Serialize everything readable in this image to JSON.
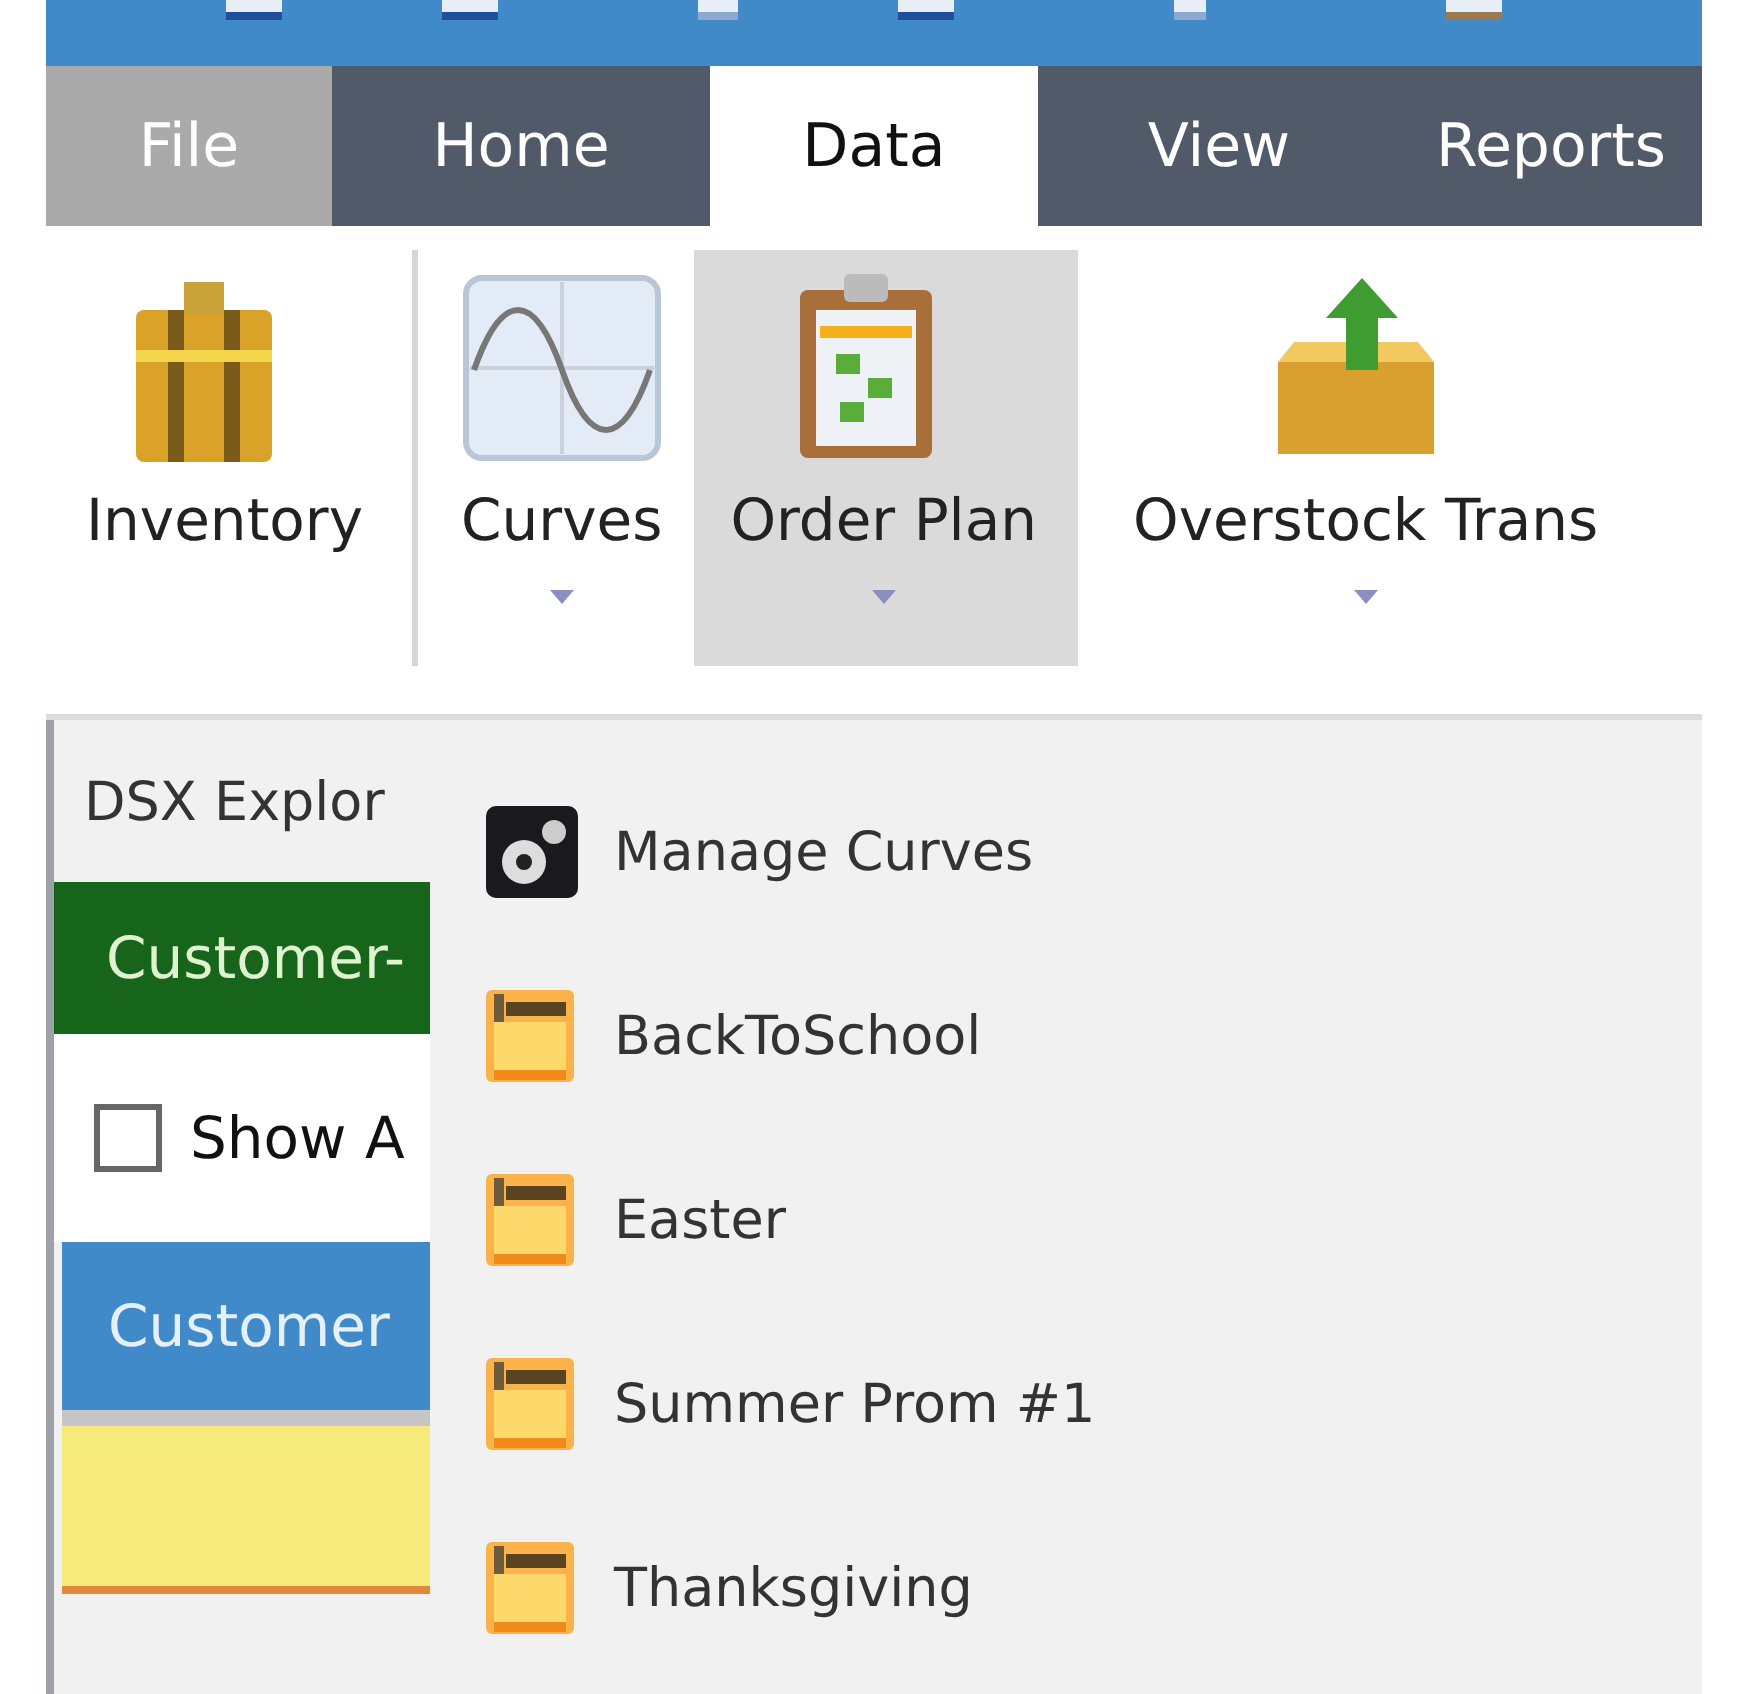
{
  "tabs": [
    {
      "label": "File",
      "kind": "backstage",
      "selected": false
    },
    {
      "label": "Home",
      "kind": "tab",
      "selected": false
    },
    {
      "label": "Data",
      "kind": "tab",
      "selected": true
    },
    {
      "label": "View",
      "kind": "tab",
      "selected": false
    },
    {
      "label": "Reports",
      "kind": "tab",
      "selected": false
    }
  ],
  "ribbon": {
    "buttons": [
      {
        "label": "Inventory",
        "dropdown": false,
        "pressed": false
      },
      {
        "label": "Curves",
        "dropdown": true,
        "pressed": false
      },
      {
        "label": "Order Plan",
        "dropdown": true,
        "pressed": true
      },
      {
        "label": "Overstock Trans",
        "dropdown": true,
        "pressed": false
      }
    ]
  },
  "explorer": {
    "title": "DSX Explor",
    "header": "Customer-",
    "show_all": {
      "label": "Show A",
      "checked": false
    },
    "column_header": "Customer"
  },
  "menu": {
    "items": [
      {
        "label": "Manage Curves",
        "kind": "manage"
      },
      {
        "label": "BackToSchool",
        "kind": "curve"
      },
      {
        "label": "Easter",
        "kind": "curve"
      },
      {
        "label": "Summer Prom #1",
        "kind": "curve"
      },
      {
        "label": "Thanksgiving",
        "kind": "curve"
      }
    ]
  }
}
